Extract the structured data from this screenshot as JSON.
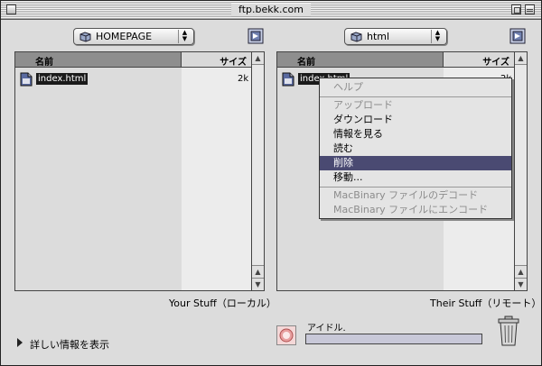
{
  "window": {
    "title": "ftp.bekk.com"
  },
  "local": {
    "folder": "HOMEPAGE",
    "col_name": "名前",
    "col_size": "サイズ",
    "files": [
      {
        "name": "index.html",
        "size": "2k"
      }
    ],
    "label": "Your Stuff（ローカル）"
  },
  "remote": {
    "folder": "html",
    "col_name": "名前",
    "col_size": "サイズ",
    "files": [
      {
        "name": "index.html",
        "size": "2k"
      }
    ],
    "label": "Their Stuff（リモート）"
  },
  "context_menu": {
    "help": "ヘルプ",
    "upload": "アップロード",
    "download": "ダウンロード",
    "get_info": "情報を見る",
    "read": "読む",
    "delete": "削除",
    "move": "移動...",
    "decode_macbinary": "MacBinary ファイルのデコード",
    "encode_macbinary": "MacBinary ファイルにエンコード"
  },
  "footer": {
    "details_toggle": "詳しい情報を表示",
    "status": "アイドル.",
    "progress": 0.0
  },
  "colors": {
    "selection": "#4a4a72",
    "header_dark": "#8e8e8e"
  },
  "icons": [
    "close-box-icon",
    "zoom-box-icon",
    "collapse-box-icon",
    "folder-icon",
    "popup-arrows-icon",
    "refresh-icon",
    "html-file-icon",
    "scroll-up-arrow-icon",
    "scroll-down-arrow-icon",
    "disclosure-triangle-icon",
    "stop-icon",
    "trash-icon"
  ]
}
